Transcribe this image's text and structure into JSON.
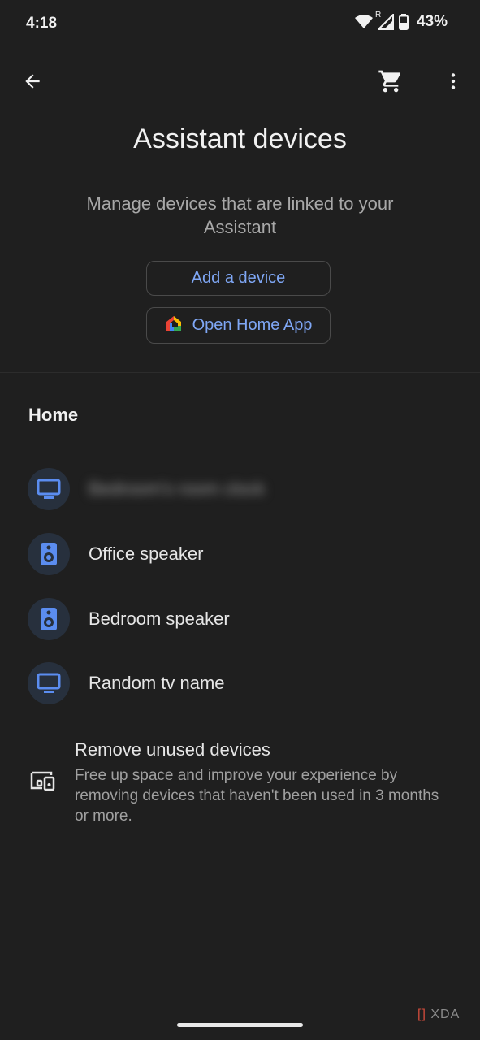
{
  "status": {
    "time": "4:18",
    "battery": "43%",
    "network_indicator": "R"
  },
  "toolbar": {
    "back_icon": "arrow-back-icon",
    "cart_icon": "shopping-cart-icon",
    "more_icon": "more-vert-icon"
  },
  "header": {
    "title": "Assistant devices",
    "subtitle": "Manage devices that are linked to your Assistant",
    "add_device_label": "Add a device",
    "open_home_label": "Open Home App"
  },
  "section": {
    "title": "Home",
    "devices": [
      {
        "label": "Bedroom's room clock",
        "icon": "tv-icon",
        "blurred": true
      },
      {
        "label": "Office speaker",
        "icon": "speaker-icon"
      },
      {
        "label": "Bedroom speaker",
        "icon": "speaker-icon"
      },
      {
        "label": "Random tv name",
        "icon": "tv-icon"
      }
    ]
  },
  "remove_unused": {
    "title": "Remove unused devices",
    "description": "Free up space and improve your experience by removing devices that haven't been used in 3 months or more.",
    "icon": "devices-icon"
  },
  "watermark": "XDA",
  "colors": {
    "background": "#1f1f1f",
    "accent_link": "#7fa7f5",
    "device_icon": "#5b8df0",
    "device_icon_bg": "#27303d"
  }
}
